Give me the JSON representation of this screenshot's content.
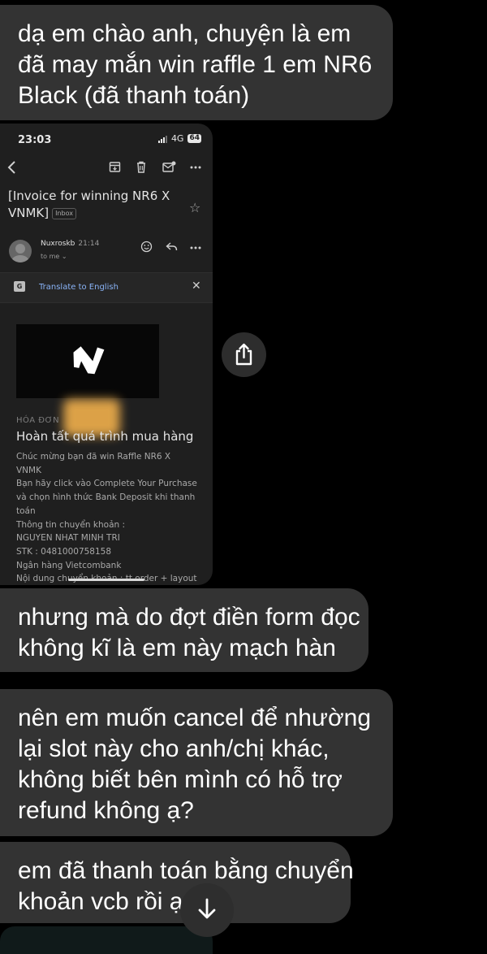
{
  "messages": [
    {
      "lines": [
        "dạ em chào anh, chuyện là em",
        "đã may mắn win raffle 1 em NR6",
        "Black (đã thanh toán)"
      ]
    },
    {
      "lines": [
        "nhưng mà do đợt điền form đọc",
        "không kĩ là em này mạch hàn"
      ]
    },
    {
      "lines": [
        "nên em muốn cancel để nhường",
        "lại slot này cho anh/chị khác,",
        "không biết bên mình có hỗ trợ",
        "refund không ạ?"
      ]
    },
    {
      "lines": [
        "em đã thanh toán bằng chuyển",
        "khoản vcb rồi ạ"
      ]
    }
  ],
  "screenshot": {
    "status_bar": {
      "time": "23:03",
      "network": "4G",
      "battery": "64"
    },
    "email": {
      "title_line1": "[Invoice for winning NR6 X",
      "title_line2": "VNMK]",
      "label": "Inbox",
      "sender": "Nuxroskb",
      "sent_time": "21:14",
      "recipient": "to me",
      "translate": "Translate to English",
      "section_label": "HÓA ĐƠN",
      "heading": "Hoàn tất quá trình mua hàng",
      "body_lines": [
        "Chúc mừng bạn đã win Raffle NR6 X",
        "VNMK",
        "Bạn hãy click vào Complete Your Purchase",
        "và chọn hình thức Bank Deposit khi thanh",
        "toán",
        "Thông tin chuyển khoản :",
        "NGUYEN NHAT MINH TRI",
        "STK : 0481000758158",
        "Ngân hàng Vietcombank",
        "Nội dung chuyển khoản : tt order + layout"
      ]
    }
  },
  "icons": {
    "share": "share-icon",
    "scroll_down": "arrow-down-icon"
  },
  "colors": {
    "bubble": "#333333",
    "background": "#000000",
    "link": "#8ab4f8"
  }
}
